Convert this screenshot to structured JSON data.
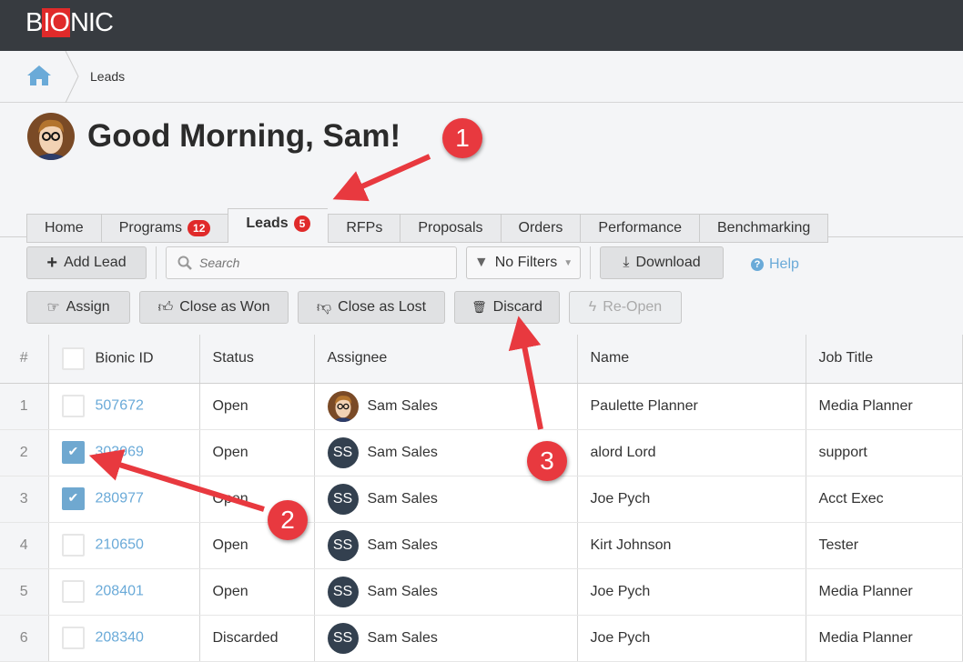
{
  "app": {
    "logo": "BIONIC",
    "logo_parts": [
      "B",
      "IO",
      "NIC"
    ],
    "brand_color": "#e02a2a"
  },
  "breadcrumb": {
    "current": "Leads"
  },
  "greeting": "Good Morning, Sam!",
  "tabs": [
    {
      "label": "Home"
    },
    {
      "label": "Programs",
      "badge": "12"
    },
    {
      "label": "Leads",
      "badge": "5",
      "active": true
    },
    {
      "label": "RFPs"
    },
    {
      "label": "Proposals"
    },
    {
      "label": "Orders"
    },
    {
      "label": "Performance"
    },
    {
      "label": "Benchmarking"
    }
  ],
  "toolbar": {
    "add_lead": "Add Lead",
    "search_placeholder": "Search",
    "filters": "No Filters",
    "download": "Download",
    "help": "Help",
    "assign": "Assign",
    "close_won": "Close as Won",
    "close_lost": "Close as Lost",
    "discard": "Discard",
    "reopen": "Re-Open"
  },
  "table": {
    "headers": [
      "#",
      "Bionic ID",
      "Status",
      "Assignee",
      "Name",
      "Job Title"
    ],
    "rows": [
      {
        "n": "1",
        "id": "507672",
        "status": "Open",
        "assignee": "Sam Sales",
        "initials": "",
        "name": "Paulette Planner",
        "title": "Media Planner",
        "checked": false
      },
      {
        "n": "2",
        "id": "303969",
        "status": "Open",
        "assignee": "Sam Sales",
        "initials": "SS",
        "name": "alord Lord",
        "title": "support",
        "checked": true
      },
      {
        "n": "3",
        "id": "280977",
        "status": "Open",
        "assignee": "Sam Sales",
        "initials": "SS",
        "name": "Joe Pych",
        "title": "Acct Exec",
        "checked": true
      },
      {
        "n": "4",
        "id": "210650",
        "status": "Open",
        "assignee": "Sam Sales",
        "initials": "SS",
        "name": "Kirt Johnson",
        "title": "Tester",
        "checked": false
      },
      {
        "n": "5",
        "id": "208401",
        "status": "Open",
        "assignee": "Sam Sales",
        "initials": "SS",
        "name": "Joe Pych",
        "title": "Media Planner",
        "checked": false
      },
      {
        "n": "6",
        "id": "208340",
        "status": "Discarded",
        "assignee": "Sam Sales",
        "initials": "SS",
        "name": "Joe Pych",
        "title": "Media Planner",
        "checked": false
      }
    ]
  },
  "annotations": [
    "1",
    "2",
    "3"
  ]
}
